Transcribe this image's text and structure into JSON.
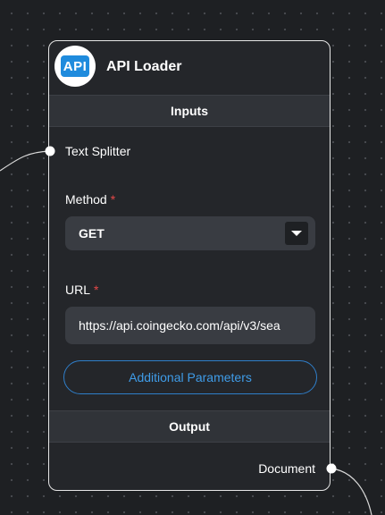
{
  "node": {
    "icon_text": "API",
    "title": "API Loader",
    "inputs_header": "Inputs",
    "output_header": "Output",
    "input_anchor_label": "Text Splitter",
    "output_anchor_label": "Document"
  },
  "fields": {
    "method": {
      "label": "Method",
      "required_mark": "*",
      "value": "GET"
    },
    "url": {
      "label": "URL",
      "required_mark": "*",
      "value": "https://api.coingecko.com/api/v3/sea"
    }
  },
  "buttons": {
    "additional_parameters": "Additional Parameters"
  },
  "colors": {
    "canvas": "#1e2023",
    "node_bg": "#24262a",
    "accent_blue": "#2f7ec9",
    "required_red": "#e54848"
  }
}
